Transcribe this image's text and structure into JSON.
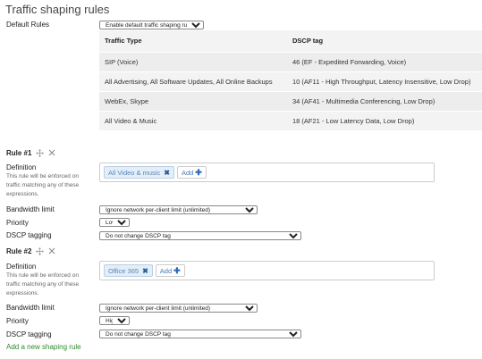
{
  "page_title": "Traffic shaping rules",
  "default_rules": {
    "label": "Default Rules",
    "select_value": "Enable default traffic shaping rules",
    "table": {
      "headers": [
        "Traffic Type",
        "DSCP tag"
      ],
      "rows": [
        [
          "SIP (Voice)",
          "46 (EF - Expedited Forwarding, Voice)"
        ],
        [
          "All Advertising, All Software Updates, All Online Backups",
          "10 (AF11 - High Throughput, Latency Insensitive, Low Drop)"
        ],
        [
          "WebEx, Skype",
          "34 (AF41 - Multimedia Conferencing, Low Drop)"
        ],
        [
          "All Video & Music",
          "18 (AF21 - Low Latency Data, Low Drop)"
        ]
      ]
    }
  },
  "rules": [
    {
      "title": "Rule #1",
      "definition_label": "Definition",
      "definition_help": "This rule will be enforced on traffic matching any of these expressions.",
      "tag": "All Video & music",
      "add_label": "Add",
      "bandwidth_label": "Bandwidth limit",
      "bandwidth_value": "Ignore network per-client limit (unlimited)",
      "priority_label": "Priority",
      "priority_value": "Low",
      "dscp_label": "DSCP tagging",
      "dscp_value": "Do not change DSCP tag"
    },
    {
      "title": "Rule #2",
      "definition_label": "Definition",
      "definition_help": "This rule will be enforced on traffic matching any of these expressions.",
      "tag": "Office 365",
      "add_label": "Add",
      "bandwidth_label": "Bandwidth limit",
      "bandwidth_value": "Ignore network per-client limit (unlimited)",
      "priority_label": "Priority",
      "priority_value": "High",
      "dscp_label": "DSCP tagging",
      "dscp_value": "Do not change DSCP tag"
    }
  ],
  "add_rule_link": "Add a new shaping rule",
  "icons": {
    "move": "move-icon",
    "close": "close-icon",
    "remove_tag": "remove-tag-icon",
    "plus": "plus-icon"
  },
  "colors": {
    "link_green": "#2e8a2e",
    "tag_bg": "#e4eef8",
    "tag_text": "#5a85b8",
    "table_bg": "#f3f3f3"
  }
}
